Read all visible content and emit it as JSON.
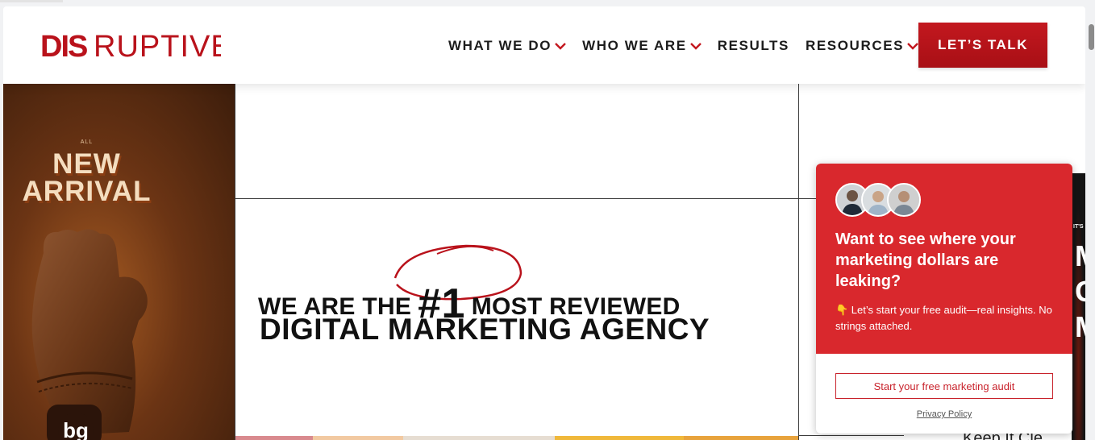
{
  "logo": {
    "text_bold": "DIS",
    "text_light": "RUPTIVE"
  },
  "nav": [
    {
      "label": "WHAT WE DO",
      "has_dropdown": true
    },
    {
      "label": "WHO WE ARE",
      "has_dropdown": true
    },
    {
      "label": "RESULTS",
      "has_dropdown": false
    },
    {
      "label": "RESOURCES",
      "has_dropdown": true
    }
  ],
  "cta": {
    "label": "LET’S TALK"
  },
  "promo": {
    "small": "ALL",
    "line1": "NEW",
    "line2": "ARRIVAL",
    "badge": "bg"
  },
  "headline": {
    "row1_before": "WE ARE THE",
    "number": "#1",
    "row1_after": "MOST REVIEWED",
    "row2": "DIGITAL MARKETING AGENCY"
  },
  "right_panel": {
    "small": "IT'S",
    "letters": [
      "M",
      "G",
      "M"
    ],
    "keep": "Keep It Cle"
  },
  "popup": {
    "title": "Want to see where your marketing dollars are leaking?",
    "subtitle": "👇 Let’s start your free audit—real insights. No strings attached.",
    "button": "Start your free marketing audit",
    "link": "Privacy Policy"
  },
  "colors": {
    "brand_red": "#c3181f",
    "popup_red": "#d9282d",
    "text_dark": "#1c1c1c"
  }
}
